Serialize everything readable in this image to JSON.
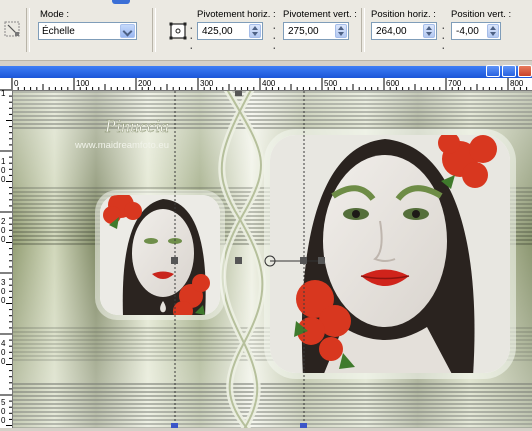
{
  "toolbar": {
    "mode_label": "Mode :",
    "mode_value": "Échelle",
    "pivot_h_label": "Pivotement horiz. :",
    "pivot_h_value": "425,00",
    "pivot_v_label": "Pivotement vert. :",
    "pivot_v_value": "275,00",
    "pos_h_label": "Position horiz. :",
    "pos_h_value": "264,00",
    "pos_v_label": "Position vert. :",
    "pos_v_value": "-4,00"
  },
  "document": {
    "watermark_logo": "Pinuccia",
    "watermark_url": "www.maidreamfoto.eu",
    "ruler_h_labels": [
      "0",
      "100",
      "200",
      "300",
      "400",
      "500",
      "600",
      "700",
      "800"
    ],
    "ruler_v_digits": [
      "1",
      "0",
      "0",
      "2",
      "0",
      "0",
      "3",
      "0",
      "0",
      "4",
      "0",
      "0",
      "5",
      "0",
      "0"
    ]
  },
  "colors": {
    "accent": "#3b6fd6",
    "canvas_green": "#a9b58e",
    "frame_white": "#f4f6ef",
    "flower_red": "#d8371f"
  }
}
